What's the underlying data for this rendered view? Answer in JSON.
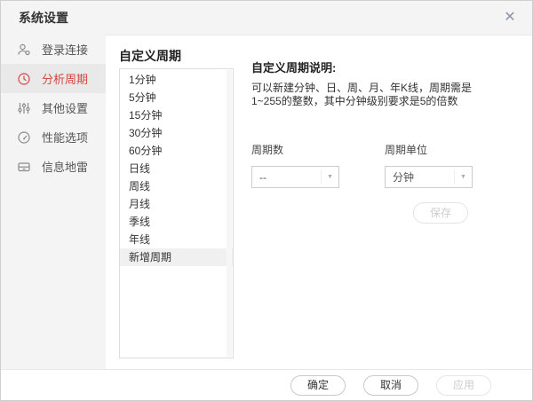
{
  "window": {
    "title": "系统设置",
    "close_glyph": "✕"
  },
  "sidebar": {
    "items": [
      {
        "label": "登录连接",
        "icon": "user-icon",
        "active": false
      },
      {
        "label": "分析周期",
        "icon": "clock-history-icon",
        "active": true
      },
      {
        "label": "其他设置",
        "icon": "sliders-icon",
        "active": false
      },
      {
        "label": "性能选项",
        "icon": "gauge-icon",
        "active": false
      },
      {
        "label": "信息地雷",
        "icon": "inbox-icon",
        "active": false
      }
    ]
  },
  "period_panel": {
    "title": "自定义周期",
    "items": [
      "1分钟",
      "5分钟",
      "15分钟",
      "30分钟",
      "60分钟",
      "日线",
      "周线",
      "月线",
      "季线",
      "年线",
      "新增周期"
    ],
    "selected_item": "新增周期"
  },
  "detail_panel": {
    "heading": "自定义周期说明:",
    "description_line1": "可以新建分钟、日、周、月、年K线，周期需是",
    "description_line2": "1~255的整数，其中分钟级别要求是5的倍数",
    "period_count": {
      "label": "周期数",
      "value": "--"
    },
    "period_unit": {
      "label": "周期单位",
      "value": "分钟"
    },
    "save_label": "保存",
    "caret_glyph": "▼"
  },
  "footer": {
    "ok_label": "确定",
    "cancel_label": "取消",
    "apply_label": "应用"
  },
  "colors": {
    "accent_red": "#d5463d",
    "sidebar_bg": "#f4f4f4",
    "selected_sidebar_bg": "#e9e9e9",
    "selected_row_bg": "#f0f0f0",
    "disabled_text": "#cccccc"
  }
}
